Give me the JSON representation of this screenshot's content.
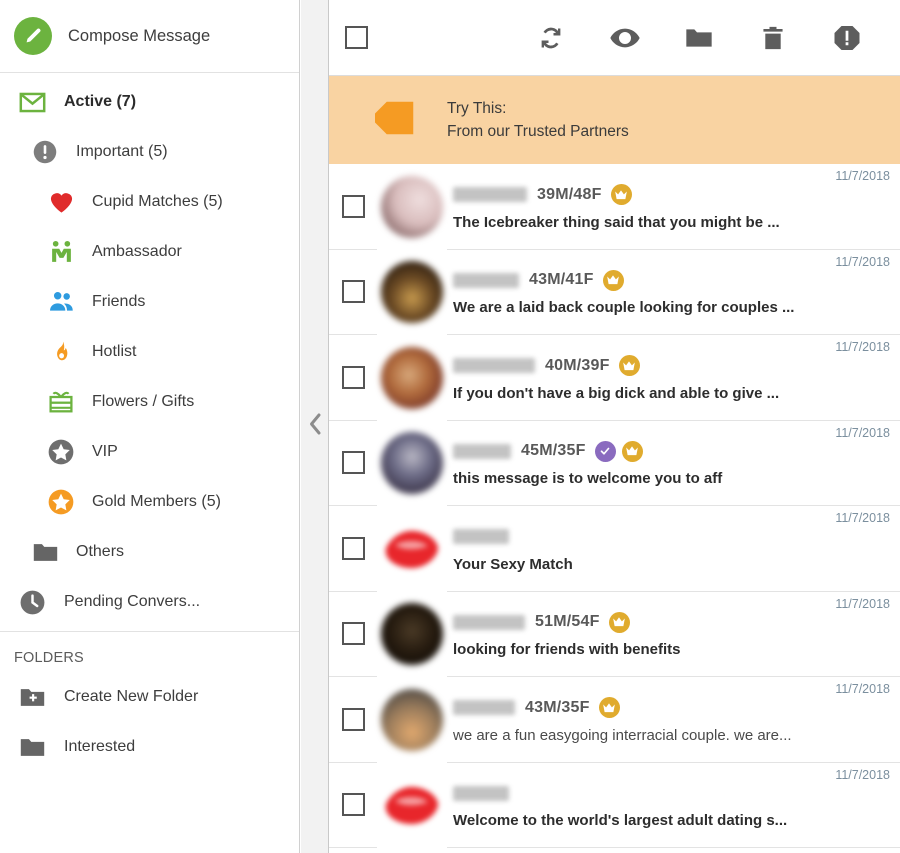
{
  "colors": {
    "green": "#6cb33f",
    "orange": "#f59b23",
    "blue": "#2e9bdf",
    "red": "#e02b2b",
    "gray": "#6e6e6e",
    "gold": "#e0ab2e",
    "purple": "#8a6bbf",
    "promo_bg": "#f9d3a2",
    "date_text": "#7b8f9e"
  },
  "sidebar": {
    "compose": {
      "label": "Compose Message",
      "icon": "pencil-circle-icon"
    },
    "nav": [
      {
        "label": "Active (7)",
        "icon": "envelope-icon",
        "level": 0,
        "bold": true,
        "count": "7"
      },
      {
        "label": "Important (5)",
        "icon": "exclamation-circle-icon",
        "level": 1,
        "bold": false,
        "count": "5"
      },
      {
        "label": "Cupid Matches (5)",
        "icon": "heart-icon",
        "level": 2,
        "bold": false,
        "count": "5"
      },
      {
        "label": "Ambassador",
        "icon": "ambassador-icon",
        "level": 2,
        "bold": false,
        "count": ""
      },
      {
        "label": "Friends",
        "icon": "friends-icon",
        "level": 2,
        "bold": false,
        "count": ""
      },
      {
        "label": "Hotlist",
        "icon": "flame-icon",
        "level": 2,
        "bold": false,
        "count": ""
      },
      {
        "label": "Flowers / Gifts",
        "icon": "gift-icon",
        "level": 2,
        "bold": false,
        "count": ""
      },
      {
        "label": "VIP",
        "icon": "star-circle-gray-icon",
        "level": 2,
        "bold": false,
        "count": ""
      },
      {
        "label": "Gold Members (5)",
        "icon": "star-circle-gold-icon",
        "level": 2,
        "bold": false,
        "count": "5"
      },
      {
        "label": "Others",
        "icon": "folder-icon",
        "level": 1,
        "bold": false,
        "count": ""
      },
      {
        "label": "Pending Convers...",
        "icon": "clock-icon",
        "level": 0,
        "bold": false,
        "count": ""
      }
    ],
    "folders_heading": "FOLDERS",
    "folders": [
      {
        "label": "Create New Folder",
        "icon": "folder-plus-icon"
      },
      {
        "label": "Interested",
        "icon": "folder-icon"
      }
    ],
    "collapse_icon": "chevron-left-icon"
  },
  "toolbar": {
    "select_all": {
      "name": "select-all-checkbox",
      "checked": false
    },
    "actions": [
      {
        "name": "refresh-icon",
        "title": "Refresh"
      },
      {
        "name": "eye-icon",
        "title": "Mark as read"
      },
      {
        "name": "folder-icon",
        "title": "Move to folder"
      },
      {
        "name": "trash-icon",
        "title": "Delete"
      },
      {
        "name": "report-icon",
        "title": "Report"
      }
    ]
  },
  "promo": {
    "icon": "price-tag-heart-icon",
    "line1": "Try This:",
    "line2": "From our Trusted Partners"
  },
  "messages": [
    {
      "username_redacted": true,
      "username_width": 74,
      "ages": "39M/48F",
      "badges": [
        "crown"
      ],
      "snippet": "The Icebreaker thing said that you might be ...",
      "unread": true,
      "date": "11/7/2018",
      "avatar": "photo-pink",
      "avatar_type": "photo"
    },
    {
      "username_redacted": true,
      "username_width": 66,
      "ages": "43M/41F",
      "badges": [
        "crown"
      ],
      "snippet": "We are a laid back couple looking for couples ...",
      "unread": true,
      "date": "11/7/2018",
      "avatar": "photo-dark",
      "avatar_type": "photo"
    },
    {
      "username_redacted": true,
      "username_width": 82,
      "ages": "40M/39F",
      "badges": [
        "crown"
      ],
      "snippet": "If you don't have a big dick and able to give ...",
      "unread": true,
      "date": "11/7/2018",
      "avatar": "photo-warm",
      "avatar_type": "photo"
    },
    {
      "username_redacted": true,
      "username_width": 58,
      "ages": "45M/35F",
      "badges": [
        "verified",
        "crown"
      ],
      "snippet": "this message is to welcome you to aff",
      "unread": true,
      "date": "11/7/2018",
      "avatar": "photo-blue",
      "avatar_type": "photo"
    },
    {
      "username_redacted": true,
      "username_width": 56,
      "ages": "",
      "badges": [],
      "snippet": "Your Sexy Match",
      "unread": true,
      "date": "11/7/2018",
      "avatar": "lips",
      "avatar_type": "lips"
    },
    {
      "username_redacted": true,
      "username_width": 72,
      "ages": "51M/54F",
      "badges": [
        "crown"
      ],
      "snippet": "looking for friends with benefits",
      "unread": true,
      "date": "11/7/2018",
      "avatar": "photo-black",
      "avatar_type": "photo"
    },
    {
      "username_redacted": true,
      "username_width": 62,
      "ages": "43M/35F",
      "badges": [
        "crown"
      ],
      "snippet": "we are a fun easygoing interracial couple. we are...",
      "unread": false,
      "date": "11/7/2018",
      "avatar": "photo-tan",
      "avatar_type": "photo"
    },
    {
      "username_redacted": true,
      "username_width": 56,
      "ages": "",
      "badges": [],
      "snippet": "Welcome to the world's largest adult dating s...",
      "unread": true,
      "date": "11/7/2018",
      "avatar": "lips",
      "avatar_type": "lips"
    }
  ]
}
